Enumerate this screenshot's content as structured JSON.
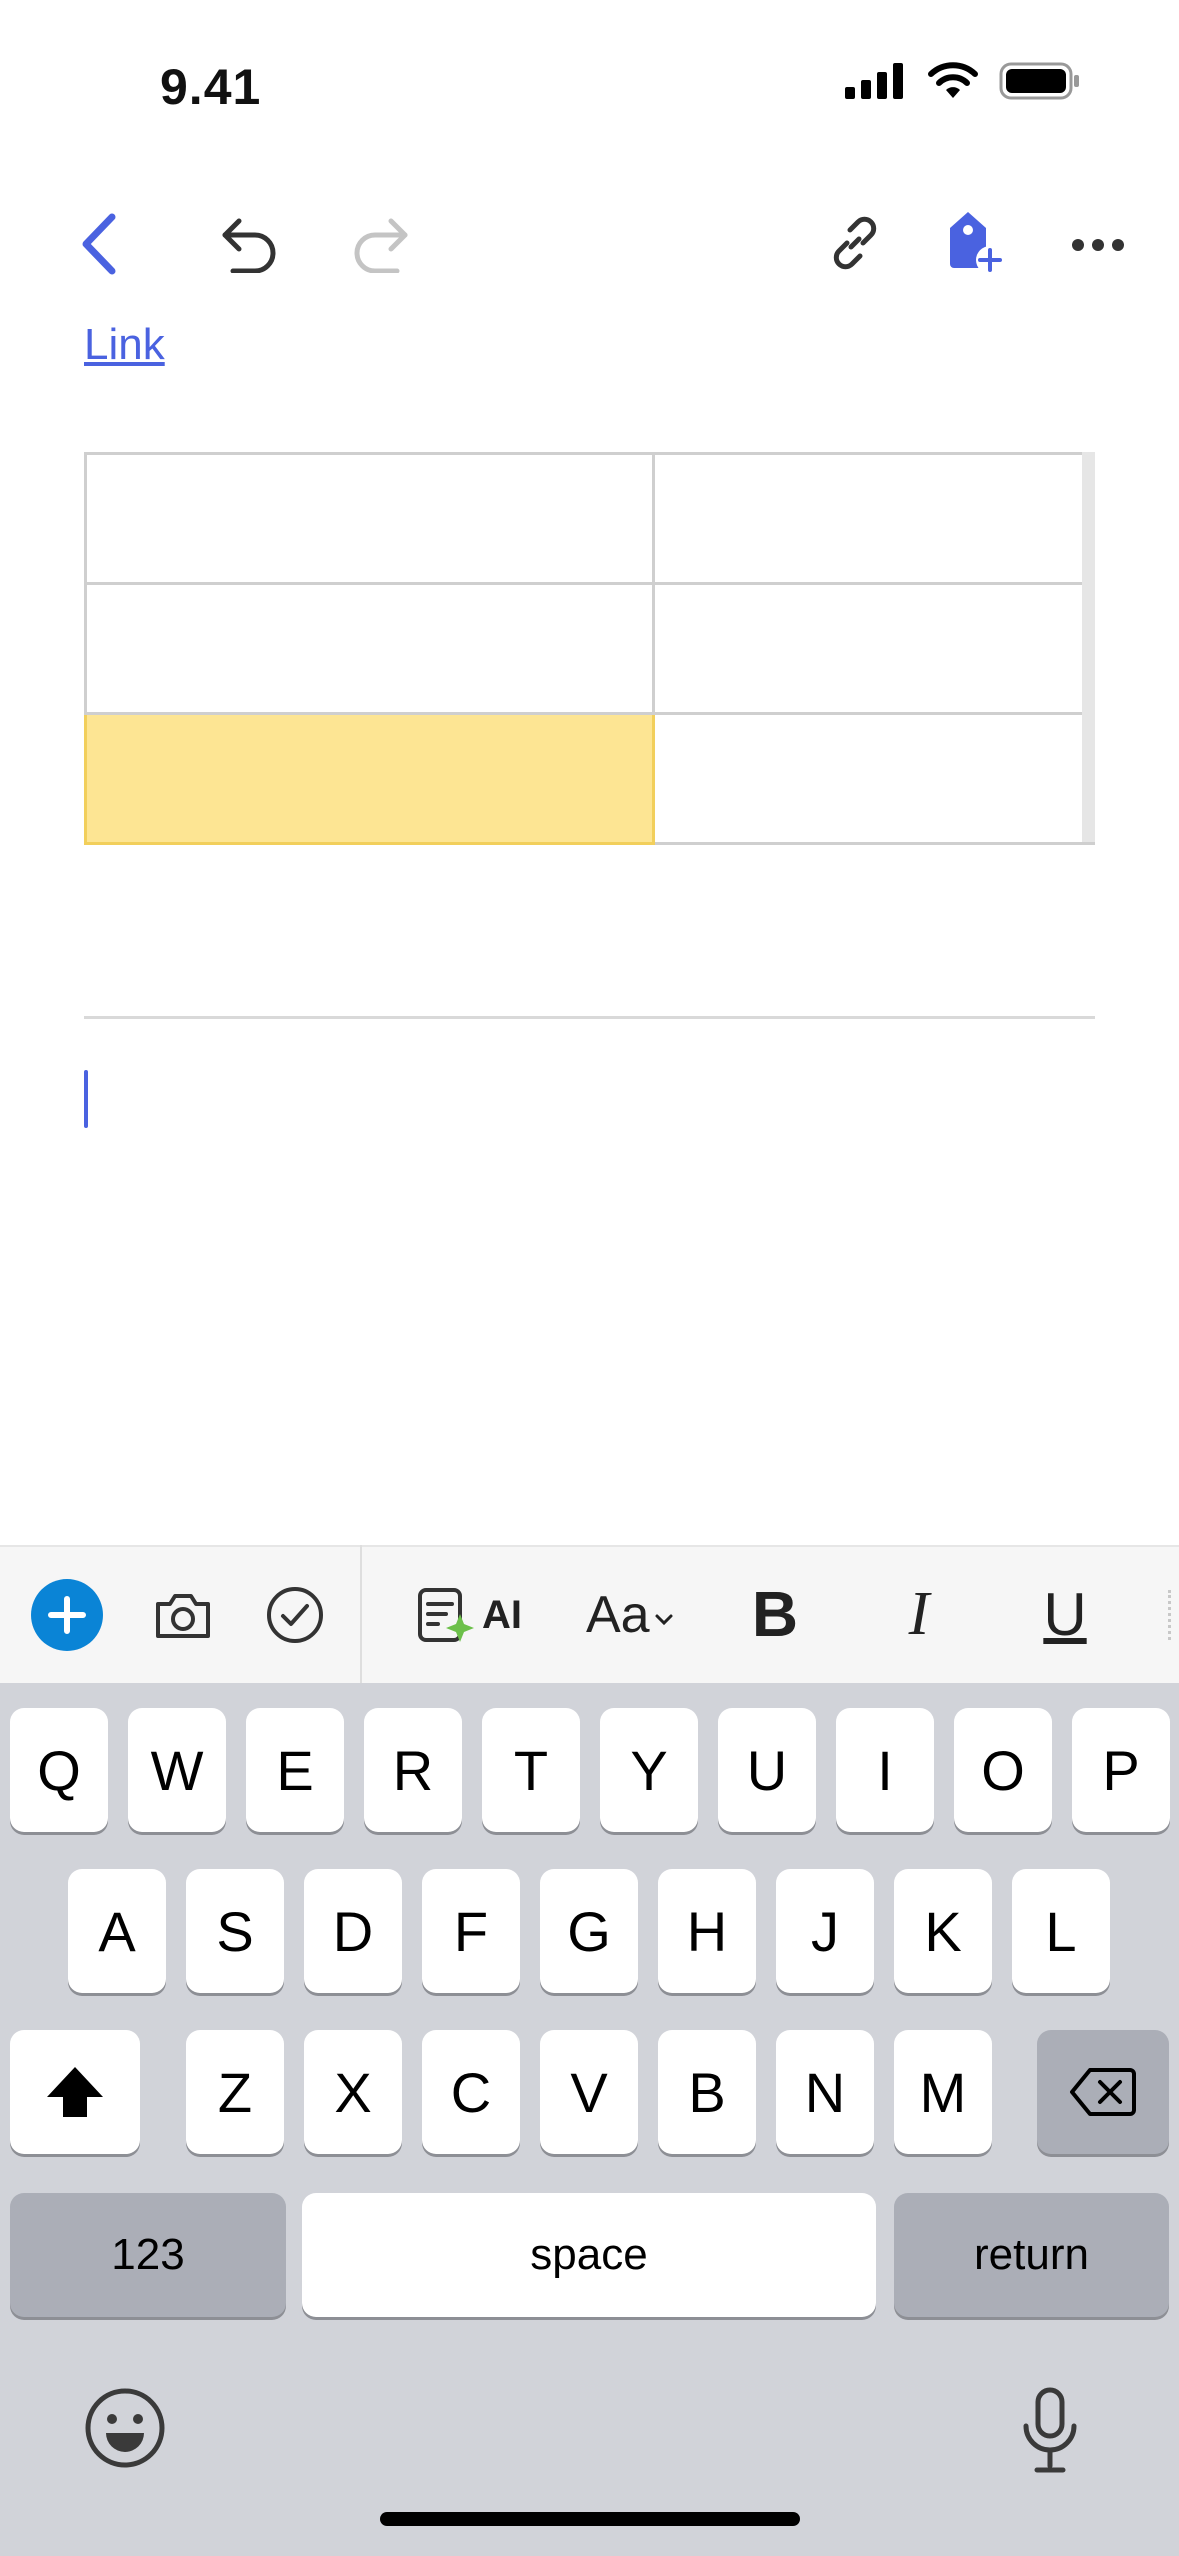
{
  "status_bar": {
    "time": "9.41"
  },
  "toolbar": {
    "back": "chevron-left-icon",
    "undo": "undo-icon",
    "redo": "redo-icon",
    "link": "link-icon",
    "tag": "tag-add-icon",
    "more": "more-icon"
  },
  "document": {
    "link_text": "Link",
    "table": {
      "rows": 3,
      "columns": 2,
      "highlighted_cell": "row 3, column 1",
      "highlight_color": "#fde593"
    }
  },
  "format_bar": {
    "ai_label": "AI",
    "text_style_label": "Aa",
    "bold_label": "B",
    "italic_label": "I",
    "underline_label": "U",
    "accent_color": "#0a84d6"
  },
  "keyboard": {
    "row1": [
      "Q",
      "W",
      "E",
      "R",
      "T",
      "Y",
      "U",
      "I",
      "O",
      "P"
    ],
    "row2": [
      "A",
      "S",
      "D",
      "F",
      "G",
      "H",
      "J",
      "K",
      "L"
    ],
    "row3": [
      "Z",
      "X",
      "C",
      "V",
      "B",
      "N",
      "M"
    ],
    "numbers_label": "123",
    "space_label": "space",
    "return_label": "return"
  },
  "colors": {
    "accent": "#4a62e0"
  }
}
